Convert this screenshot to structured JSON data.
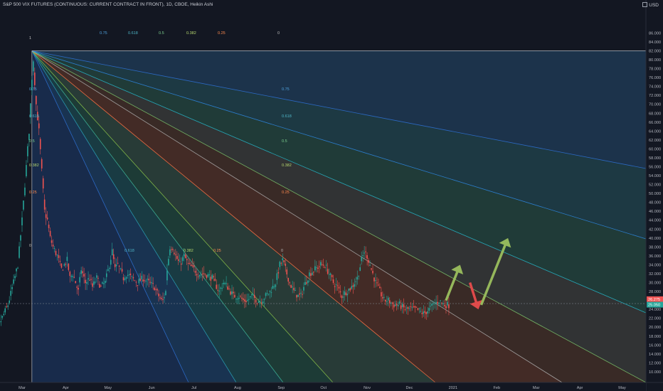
{
  "header": {
    "title": "S&P 500 VIX FUTURES (CONTINUOUS: CURRENT CONTRACT IN FRONT), 1D, CBOE, Heikin Ashi",
    "currency": "USD"
  },
  "colors": {
    "background": "#131722",
    "up": "#26a69a",
    "down": "#ef5350",
    "arrow_up": "#9bbf5e",
    "arrow_down": "#e84c4c",
    "price_tag_red": "#f05454",
    "price_tag_green": "#26a69a"
  },
  "chart_data": {
    "type": "candlestick",
    "title": "S&P 500 VIX FUTURES (CONTINUOUS: CURRENT CONTRACT IN FRONT), 1D, CBOE, Heikin Ashi",
    "ylim": [
      9,
      87.5
    ],
    "y_ticks": [
      "86.000",
      "84.000",
      "82.000",
      "80.000",
      "78.000",
      "76.000",
      "74.000",
      "72.000",
      "70.000",
      "68.000",
      "66.000",
      "64.000",
      "62.000",
      "60.000",
      "58.000",
      "56.000",
      "54.000",
      "52.000",
      "50.000",
      "48.000",
      "46.000",
      "44.000",
      "42.000",
      "40.000",
      "38.000",
      "36.000",
      "34.000",
      "32.000",
      "30.000",
      "28.000",
      "26.000",
      "24.000",
      "22.000",
      "20.000",
      "18.000",
      "16.000",
      "14.000",
      "12.000",
      "10.000"
    ],
    "x_ticks": [
      {
        "label": "Mar",
        "day": 0
      },
      {
        "label": "Apr",
        "day": 31
      },
      {
        "label": "May",
        "day": 61
      },
      {
        "label": "Jun",
        "day": 92
      },
      {
        "label": "Jul",
        "day": 122
      },
      {
        "label": "Aug",
        "day": 153
      },
      {
        "label": "Sep",
        "day": 184
      },
      {
        "label": "Oct",
        "day": 214
      },
      {
        "label": "Nov",
        "day": 245
      },
      {
        "label": "Dec",
        "day": 275
      },
      {
        "label": "2021",
        "day": 306
      },
      {
        "label": "Feb",
        "day": 337
      },
      {
        "label": "Mar",
        "day": 365
      },
      {
        "label": "Apr",
        "day": 396
      },
      {
        "label": "May",
        "day": 426
      }
    ],
    "price_tags": [
      {
        "value": "26.275",
        "color": "red"
      },
      {
        "value": "25.050",
        "color": "green"
      }
    ],
    "price_keypoints": [
      [
        -24,
        16
      ],
      [
        -17,
        20
      ],
      [
        -10,
        25
      ],
      [
        -6,
        30
      ],
      [
        -3,
        34
      ],
      [
        0,
        44
      ],
      [
        3,
        56
      ],
      [
        5,
        64
      ],
      [
        7,
        76
      ],
      [
        8,
        80
      ],
      [
        10,
        70
      ],
      [
        12,
        64
      ],
      [
        14,
        55
      ],
      [
        16,
        46
      ],
      [
        18,
        44
      ],
      [
        20,
        40
      ],
      [
        22,
        38
      ],
      [
        25,
        36
      ],
      [
        28,
        33
      ],
      [
        30,
        34
      ],
      [
        32,
        35
      ],
      [
        34,
        31
      ],
      [
        36,
        32
      ],
      [
        38,
        30
      ],
      [
        40,
        28
      ],
      [
        42,
        33
      ],
      [
        45,
        30
      ],
      [
        48,
        31
      ],
      [
        50,
        29
      ],
      [
        53,
        31
      ],
      [
        56,
        29
      ],
      [
        59,
        30
      ],
      [
        62,
        34
      ],
      [
        64,
        37
      ],
      [
        66,
        33
      ],
      [
        68,
        34
      ],
      [
        72,
        31
      ],
      [
        74,
        32
      ],
      [
        78,
        31
      ],
      [
        82,
        30
      ],
      [
        86,
        31
      ],
      [
        90,
        30
      ],
      [
        94,
        29
      ],
      [
        97,
        27
      ],
      [
        99,
        26
      ],
      [
        100,
        26
      ],
      [
        102,
        28
      ],
      [
        103,
        33
      ],
      [
        105,
        38
      ],
      [
        107,
        38
      ],
      [
        109,
        36
      ],
      [
        112,
        34
      ],
      [
        115,
        36
      ],
      [
        118,
        34
      ],
      [
        122,
        33
      ],
      [
        125,
        32
      ],
      [
        130,
        32
      ],
      [
        135,
        31
      ],
      [
        140,
        28
      ],
      [
        143,
        30
      ],
      [
        146,
        29
      ],
      [
        150,
        27
      ],
      [
        154,
        27
      ],
      [
        157,
        26
      ],
      [
        160,
        26
      ],
      [
        163,
        27
      ],
      [
        167,
        26
      ],
      [
        170,
        26
      ],
      [
        173,
        27
      ],
      [
        176,
        28
      ],
      [
        180,
        30
      ],
      [
        183,
        34
      ],
      [
        185,
        35
      ],
      [
        187,
        33
      ],
      [
        190,
        30
      ],
      [
        193,
        28
      ],
      [
        196,
        27
      ],
      [
        198,
        27
      ],
      [
        200,
        29
      ],
      [
        204,
        32
      ],
      [
        208,
        33
      ],
      [
        212,
        34
      ],
      [
        215,
        34
      ],
      [
        218,
        32
      ],
      [
        221,
        30
      ],
      [
        224,
        29
      ],
      [
        227,
        27
      ],
      [
        230,
        28
      ],
      [
        234,
        29
      ],
      [
        238,
        31
      ],
      [
        241,
        35
      ],
      [
        243,
        37
      ],
      [
        245,
        36
      ],
      [
        248,
        33
      ],
      [
        251,
        30
      ],
      [
        254,
        28
      ],
      [
        257,
        26
      ],
      [
        260,
        26
      ],
      [
        264,
        25
      ],
      [
        268,
        25
      ],
      [
        272,
        24
      ],
      [
        276,
        24
      ],
      [
        280,
        24
      ],
      [
        285,
        23
      ],
      [
        289,
        24
      ],
      [
        292,
        25
      ],
      [
        296,
        26
      ],
      [
        300,
        25
      ],
      [
        303,
        25
      ]
    ],
    "fib_fan": {
      "origin": {
        "day": 7,
        "value": 82
      },
      "levels_top": [
        "0.75",
        "0.618",
        "0.5",
        "0.382",
        "0.25",
        "0"
      ],
      "levels_mid": [
        "0.75",
        "0.618",
        "0.5",
        "0.382",
        "0.25"
      ],
      "levels_left": [
        "1",
        "0.75",
        "0.618",
        "0.5",
        "0.382",
        "0.25",
        "0"
      ],
      "levels_inner": [
        "0.618",
        "0.382",
        "0.25",
        "0"
      ]
    },
    "annotations": [
      {
        "type": "arrow-up",
        "color": "arrow_up",
        "from": [
          301,
          26
        ],
        "to": [
          311,
          34
        ]
      },
      {
        "type": "arrow-down",
        "color": "arrow_down",
        "from": [
          318,
          30
        ],
        "to": [
          324,
          24
        ]
      },
      {
        "type": "arrow-up",
        "color": "arrow_up",
        "from": [
          326,
          25
        ],
        "to": [
          345,
          40
        ]
      }
    ]
  }
}
